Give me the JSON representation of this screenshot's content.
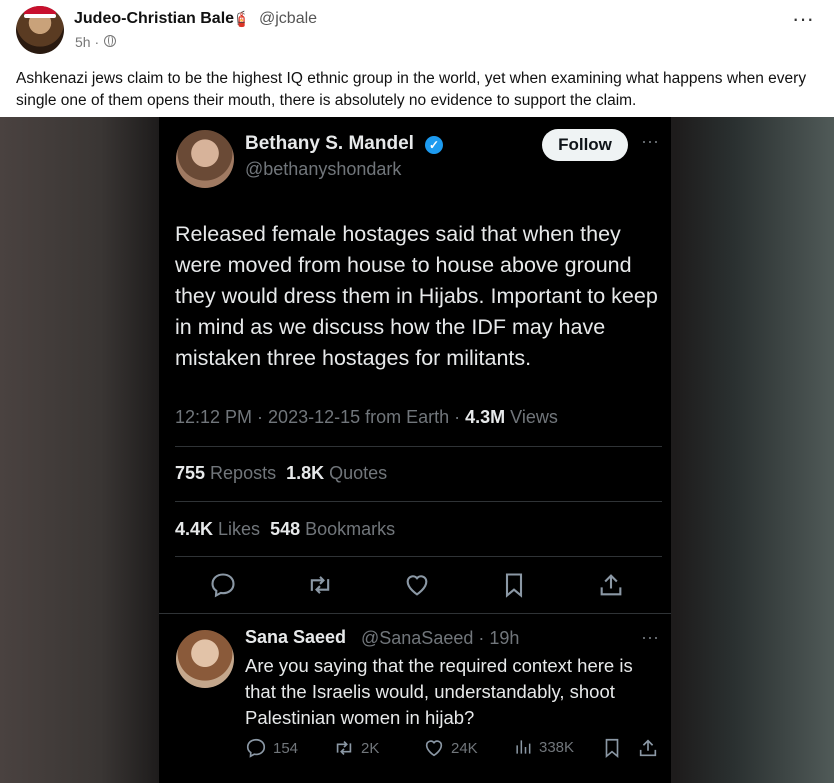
{
  "post": {
    "author_name": "Judeo-Christian Bale",
    "author_emoji": "🧯",
    "author_handle": "@jcbale",
    "time": "5h ·",
    "text": "Ashkenazi jews claim to be the highest IQ ethnic group in the world, yet when examining what happens when every single one of them opens their mouth, there is absolutely no evidence to support the claim.",
    "more": "···"
  },
  "embedded": {
    "name": "Bethany S. Mandel",
    "verified": "✓",
    "handle": "@bethanyshondark",
    "follow": "Follow",
    "more": "···",
    "body": "Released female hostages said that when they were moved from house to house above ground they would dress them in Hijabs.  Important to keep in mind as we discuss how the IDF may have mistaken three hostages for militants.",
    "time": "12:12 PM · 2023-12-15 from Earth · ",
    "views_count": "4.3M",
    "views_label": " Views",
    "reposts_count": "755",
    "reposts_label": " Reposts  ",
    "quotes_count": "1.8K",
    "quotes_label": " Quotes",
    "likes_count": "4.4K",
    "likes_label": " Likes  ",
    "bookmarks_count": "548",
    "bookmarks_label": " Bookmarks"
  },
  "reply": {
    "name": "Sana Saeed",
    "handle": "@SanaSaeed · 19h",
    "more": "···",
    "body": "Are you saying that the required context here is that the Israelis would, understandably, shoot Palestinian women in hijab?",
    "replies": "154",
    "reposts": "2K",
    "likes": "24K",
    "views": "338K"
  }
}
